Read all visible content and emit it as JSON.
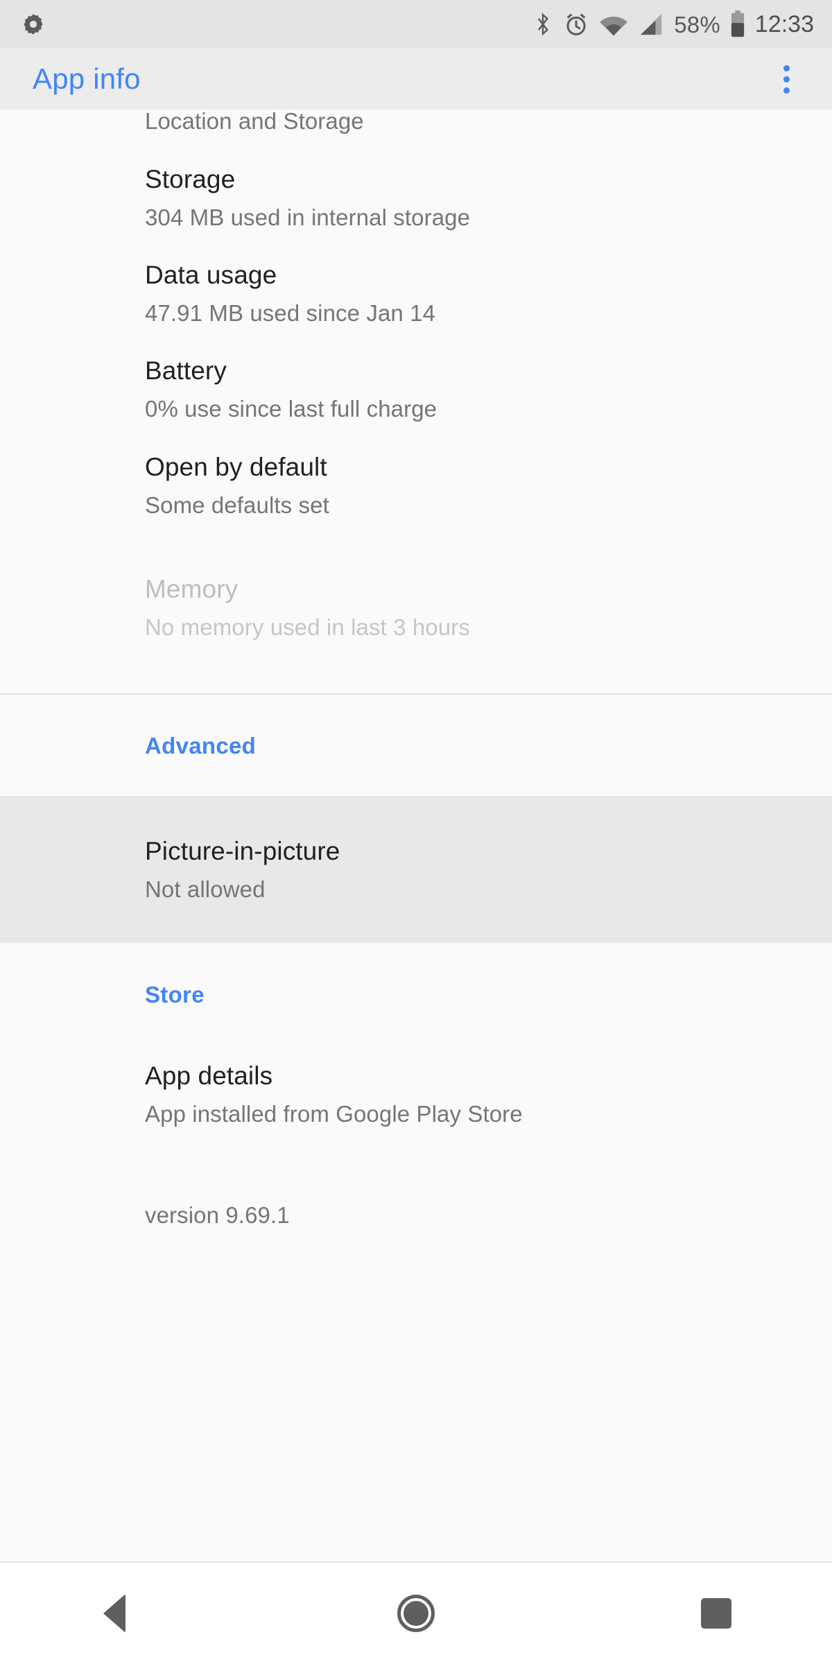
{
  "status_bar": {
    "icons": [
      "settings-gear-icon",
      "bluetooth-icon",
      "alarm-icon",
      "wifi-icon",
      "cellular-signal-icon",
      "battery-icon"
    ],
    "battery_percent": "58%",
    "clock": "12:33"
  },
  "app_bar": {
    "title": "App info",
    "overflow_label": "More options",
    "accent_color": "#4285f4"
  },
  "content": {
    "clipped_item": {
      "summary": "Location and Storage"
    },
    "items": [
      {
        "title": "Storage",
        "summary": "304 MB used in internal storage"
      },
      {
        "title": "Data usage",
        "summary": "47.91 MB used since Jan 14"
      },
      {
        "title": "Battery",
        "summary": "0% use since last full charge"
      },
      {
        "title": "Open by default",
        "summary": "Some defaults set"
      },
      {
        "title": "Memory",
        "summary": "No memory used in last 3 hours"
      }
    ],
    "advanced_category": "Advanced",
    "pip_item": {
      "title": "Picture-in-picture",
      "summary": "Not allowed"
    },
    "store_category": "Store",
    "store_item": {
      "title": "App details",
      "summary": "App installed from Google Play Store"
    },
    "version": "version 9.69.1"
  },
  "nav_bar": {
    "back": "Back",
    "home": "Home",
    "recents": "Recent apps"
  }
}
